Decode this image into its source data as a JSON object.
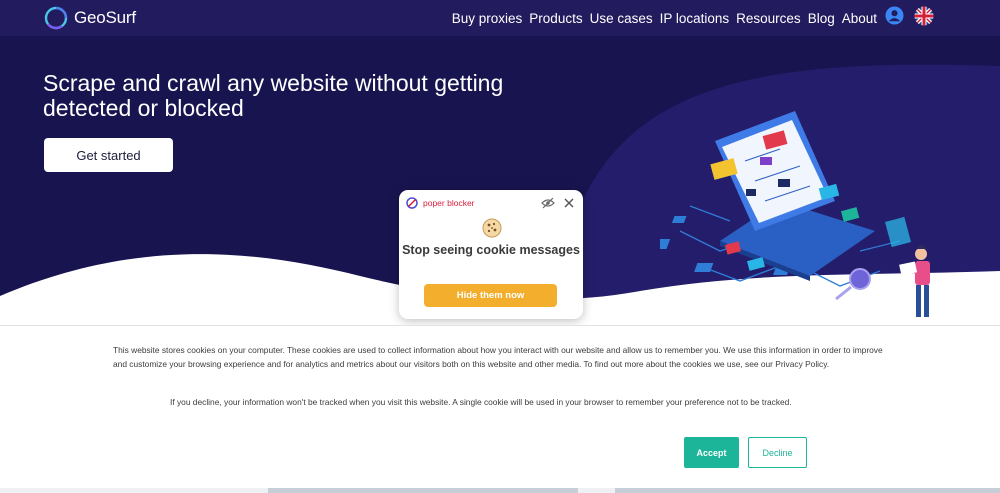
{
  "header": {
    "logo_text": "GeoSurf",
    "nav": [
      "Buy proxies",
      "Products",
      "Use cases",
      "IP locations",
      "Resources",
      "Blog",
      "About"
    ],
    "user_icon": "user-circle-icon",
    "flag_icon": "uk-flag-icon"
  },
  "hero": {
    "title": "Scrape and crawl any website without getting detected or blocked",
    "cta_label": "Get started"
  },
  "popup": {
    "brand": "poper blocker",
    "message": "Stop seeing cookie messages",
    "button_label": "Hide them now"
  },
  "cookie_banner": {
    "paragraph_1": "This website stores cookies on your computer. These cookies are used to collect information about how you interact with our website and allow us to remember you. We use this information in order to improve and customize your browsing experience and for analytics and metrics about our visitors both on this website and other media. To find out more about the cookies we use, see our Privacy Policy.",
    "paragraph_2": "If you decline, your information won't be tracked when you visit this website. A single cookie will be used in your browser to remember your preference not to be tracked.",
    "accept_label": "Accept",
    "decline_label": "Decline"
  },
  "colors": {
    "nav_bg": "#221b5e",
    "hero_bg": "#18144f",
    "accent_teal": "#1db59a",
    "popup_orange": "#f3ae2d",
    "poper_red": "#d81e3a"
  }
}
